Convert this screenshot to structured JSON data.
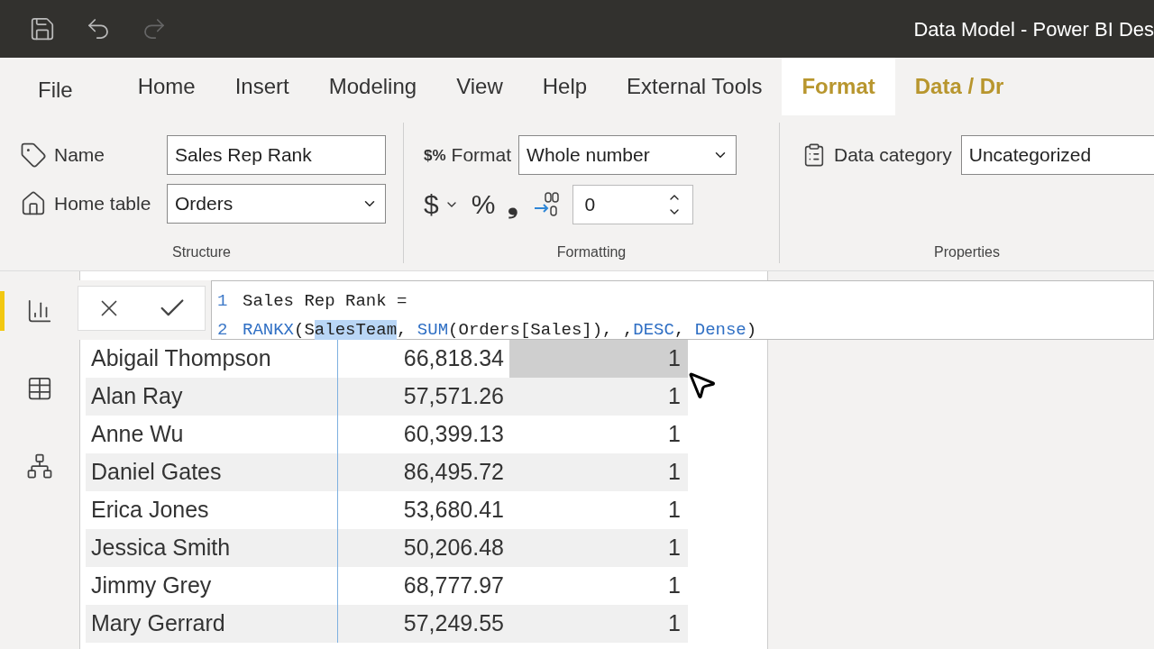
{
  "window": {
    "title": "Data Model - Power BI Des"
  },
  "menu_tabs": [
    {
      "label": "File",
      "selected": false,
      "kind": "file"
    },
    {
      "label": "Home",
      "selected": false,
      "kind": "main"
    },
    {
      "label": "Insert",
      "selected": false,
      "kind": "main"
    },
    {
      "label": "Modeling",
      "selected": false,
      "kind": "main"
    },
    {
      "label": "View",
      "selected": false,
      "kind": "main"
    },
    {
      "label": "Help",
      "selected": false,
      "kind": "main"
    },
    {
      "label": "External Tools",
      "selected": false,
      "kind": "main"
    },
    {
      "label": "Format",
      "selected": true,
      "kind": "context"
    },
    {
      "label": "Data / Dr",
      "selected": false,
      "kind": "context"
    }
  ],
  "structure": {
    "group": "Structure",
    "name_label": "Name",
    "name_value": "Sales Rep Rank",
    "home_table_label": "Home table",
    "home_table_value": "Orders"
  },
  "formatting": {
    "group": "Formatting",
    "format_icon": "$%",
    "format_label": "Format",
    "format_value": "Whole number",
    "currency": "$",
    "percent": "%",
    "comma": "❟",
    "decimals": "0"
  },
  "properties": {
    "group": "Properties",
    "category_label": "Data category",
    "category_value": "Uncategorized"
  },
  "sidebar": [
    {
      "kind": "report",
      "selected": true
    },
    {
      "kind": "data",
      "selected": false
    },
    {
      "kind": "model",
      "selected": false
    }
  ],
  "formula": {
    "lines": [
      {
        "number": "1",
        "tokens": [
          {
            "text": "Sales Rep Rank =",
            "kind": "plain"
          }
        ]
      },
      {
        "number": "2",
        "tokens": [
          {
            "text": "RANKX",
            "kind": "function"
          },
          {
            "text": "(S",
            "kind": "plain"
          },
          {
            "text": "alesTeam",
            "kind": "selected"
          },
          {
            "text": ", ",
            "kind": "plain"
          },
          {
            "text": "SUM",
            "kind": "function"
          },
          {
            "text": "(Orders[Sales]), ,",
            "kind": "plain"
          },
          {
            "text": "DESC",
            "kind": "function"
          },
          {
            "text": ", ",
            "kind": "plain"
          },
          {
            "text": "Dense",
            "kind": "function"
          },
          {
            "text": ")",
            "kind": "plain"
          }
        ]
      }
    ]
  },
  "table": {
    "rows": [
      {
        "name": "Abigail Thompson",
        "sales": "66,818.34",
        "rank": "1",
        "hovered": true
      },
      {
        "name": "Alan Ray",
        "sales": "57,571.26",
        "rank": "1",
        "hovered": false
      },
      {
        "name": "Anne Wu",
        "sales": "60,399.13",
        "rank": "1",
        "hovered": false
      },
      {
        "name": "Daniel Gates",
        "sales": "86,495.72",
        "rank": "1",
        "hovered": false
      },
      {
        "name": "Erica Jones",
        "sales": "53,680.41",
        "rank": "1",
        "hovered": false
      },
      {
        "name": "Jessica Smith",
        "sales": "50,206.48",
        "rank": "1",
        "hovered": false
      },
      {
        "name": "Jimmy Grey",
        "sales": "68,777.97",
        "rank": "1",
        "hovered": false
      },
      {
        "name": "Mary Gerrard",
        "sales": "57,249.55",
        "rank": "1",
        "hovered": false
      }
    ]
  }
}
